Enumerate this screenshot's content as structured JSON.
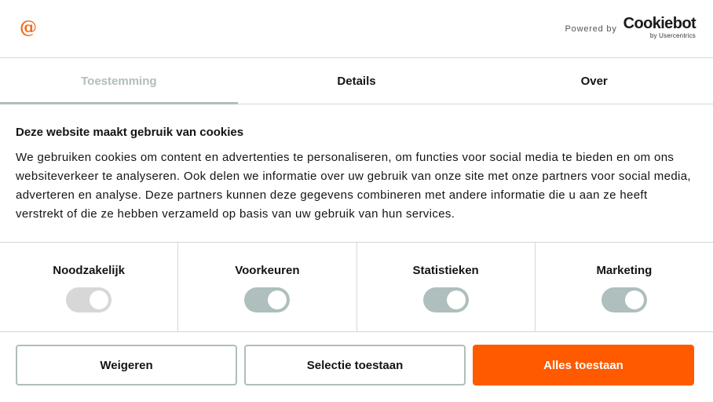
{
  "header": {
    "logo_glyph": "@",
    "powered_by": "Powered by",
    "brand_name": "Cookiebot",
    "brand_sub": "by Usercentrics"
  },
  "tabs": [
    {
      "label": "Toestemming",
      "active": true
    },
    {
      "label": "Details",
      "active": false
    },
    {
      "label": "Over",
      "active": false
    }
  ],
  "content": {
    "title": "Deze website maakt gebruik van cookies",
    "body": "We gebruiken cookies om content en advertenties te personaliseren, om functies voor social media te bieden en om ons websiteverkeer te analyseren. Ook delen we informatie over uw gebruik van onze site met onze partners voor social media, adverteren en analyse. Deze partners kunnen deze gegevens combineren met andere informatie die u aan ze heeft verstrekt of die ze hebben verzameld op basis van uw gebruik van hun services."
  },
  "categories": [
    {
      "label": "Noodzakelijk",
      "checked": true,
      "disabled": true
    },
    {
      "label": "Voorkeuren",
      "checked": true,
      "disabled": false
    },
    {
      "label": "Statistieken",
      "checked": true,
      "disabled": false
    },
    {
      "label": "Marketing",
      "checked": true,
      "disabled": false
    }
  ],
  "buttons": {
    "deny": "Weigeren",
    "allow_selection": "Selectie toestaan",
    "allow_all": "Alles toestaan"
  },
  "colors": {
    "accent": "#aebfbd",
    "primary": "#ff5a00",
    "logo": "#f06b1a"
  }
}
